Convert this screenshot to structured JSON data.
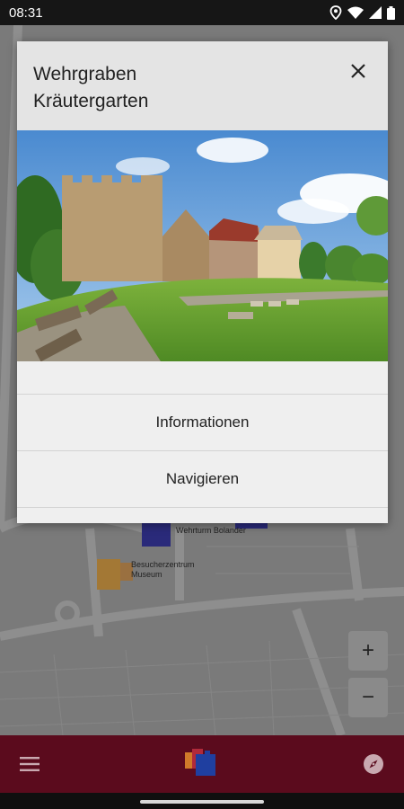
{
  "status_bar": {
    "time": "08:31"
  },
  "dialog": {
    "title_line1": "Wehrgraben",
    "title_line2": "Kräutergarten",
    "actions": [
      {
        "label": "Informationen"
      },
      {
        "label": "Navigieren"
      }
    ]
  },
  "map": {
    "labels": [
      {
        "text": "Wehrturm Bolander"
      },
      {
        "text": "Besucherzentrum"
      },
      {
        "text": "Museum"
      }
    ],
    "zoom_in": "+",
    "zoom_out": "−"
  },
  "colors": {
    "bottom_bar": "#5b0b1d",
    "dialog_bg": "#efefef",
    "map_bg": "#7a7a7a"
  },
  "icons": {
    "menu": "menu-icon",
    "logo": "app-logo-icon",
    "compass": "compass-icon",
    "close": "close-icon"
  }
}
